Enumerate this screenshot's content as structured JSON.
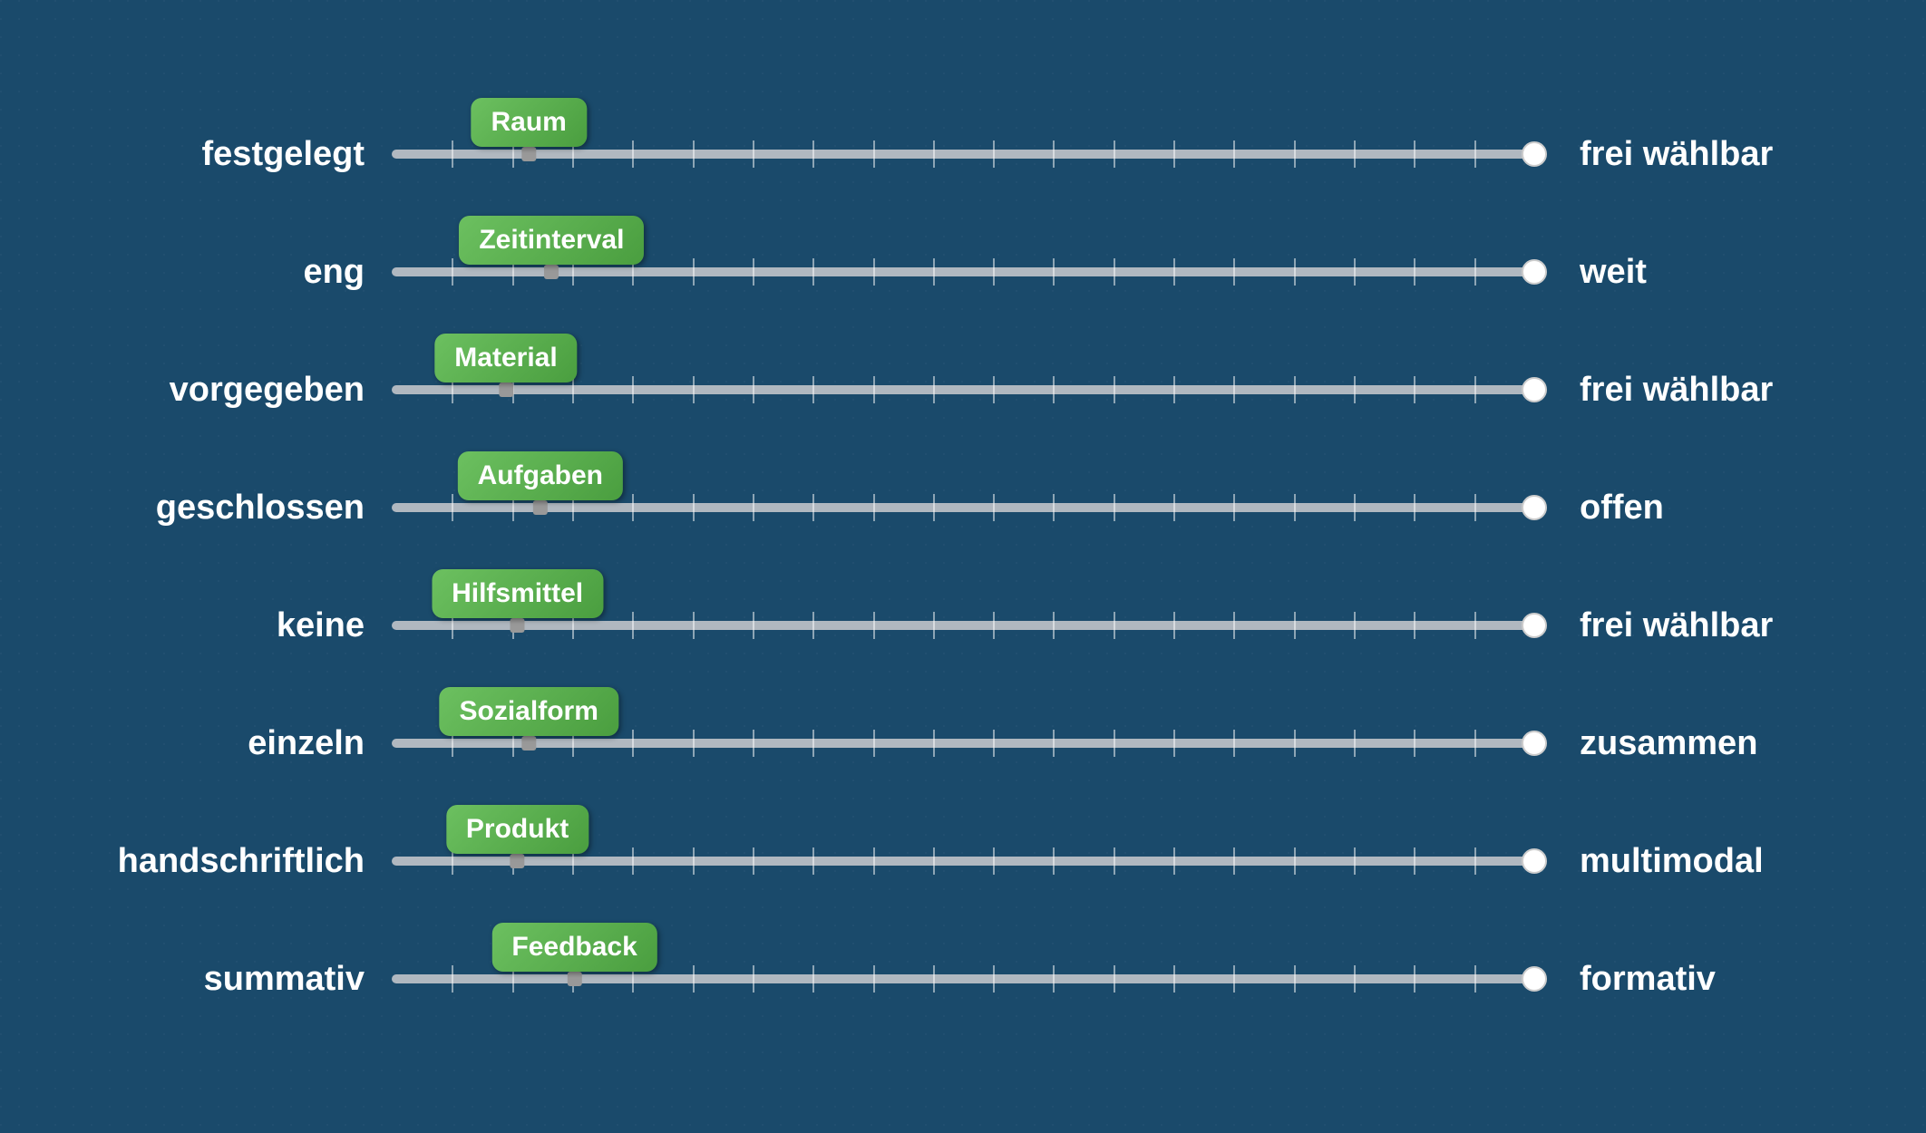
{
  "sliders": [
    {
      "left": "festgelegt",
      "label": "Raum",
      "right": "frei wählbar",
      "position": 0.12
    },
    {
      "left": "eng",
      "label": "Zeitinterval",
      "right": "weit",
      "position": 0.14
    },
    {
      "left": "vorgegeben",
      "label": "Material",
      "right": "frei wählbar",
      "position": 0.1
    },
    {
      "left": "geschlossen",
      "label": "Aufgaben",
      "right": "offen",
      "position": 0.13
    },
    {
      "left": "keine",
      "label": "Hilfsmittel",
      "right": "frei wählbar",
      "position": 0.11
    },
    {
      "left": "einzeln",
      "label": "Sozialform",
      "right": "zusammen",
      "position": 0.12
    },
    {
      "left": "handschriftlich",
      "label": "Produkt",
      "right": "multimodal",
      "position": 0.11
    },
    {
      "left": "summativ",
      "label": "Feedback",
      "right": "formativ",
      "position": 0.16
    }
  ],
  "tickCount": 18
}
